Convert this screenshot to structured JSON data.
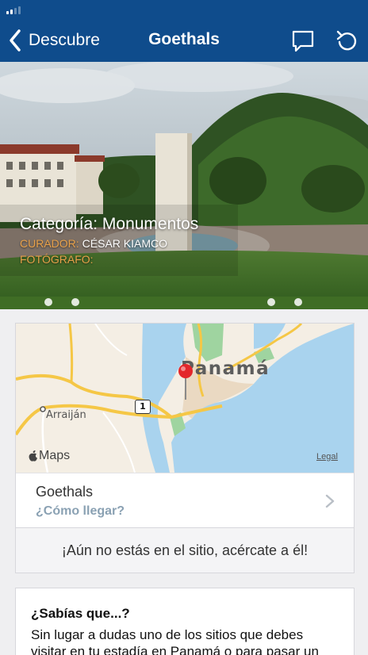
{
  "nav": {
    "back_label": "Descubre",
    "title": "Goethals"
  },
  "hero": {
    "category_label": "Categoría: Monumentos",
    "curator_key": "CURADOR:",
    "curator_value": "CÉSAR KIAMCO",
    "photographer_key": "FOTÓGRAFO:",
    "photographer_value": "",
    "slide_count": 4
  },
  "map": {
    "city_label": "Panamá",
    "town_label": "Arraiján",
    "road_number": "1",
    "brand_label": "Maps",
    "legal_label": "Legal",
    "colors": {
      "water": "#a9d3ee",
      "land": "#f4eee4",
      "park": "#9fd4a0",
      "road": "#f5c746"
    }
  },
  "place": {
    "name": "Goethals",
    "directions_label": "¿Cómo llegar?",
    "proximity_message": "¡Aún no estás en el sitio, acércate a él!"
  },
  "info": {
    "title": "¿Sabías que...?",
    "body": "Sin lugar a dudas uno de los sitios que debes visitar en tu estadía en Panamá o para pasar un"
  },
  "colors": {
    "nav_bg": "#0f4c8c",
    "accent_orange": "#e8a14a",
    "link_gray_blue": "#8aa1b3"
  }
}
